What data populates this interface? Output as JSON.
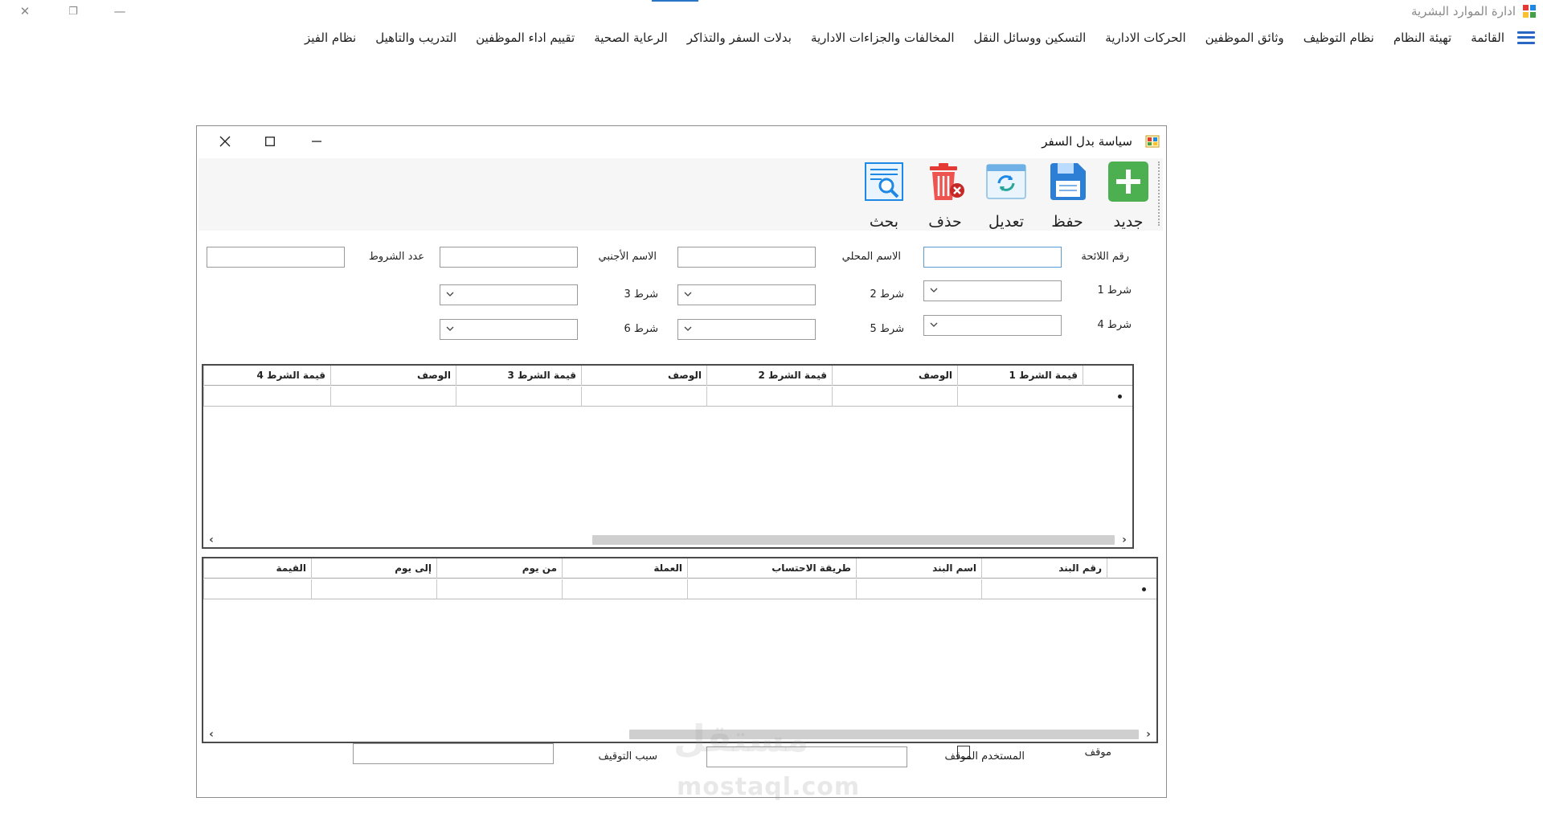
{
  "app": {
    "title": "ادارة الموارد البشرية",
    "minimize_glyph": "—",
    "restore_glyph": "❐",
    "close_glyph": "✕"
  },
  "menu": {
    "items": [
      {
        "label": "القائمة"
      },
      {
        "label": "تهيئة النظام"
      },
      {
        "label": "نظام التوظيف"
      },
      {
        "label": "وثائق الموظفين"
      },
      {
        "label": "الحركات الادارية"
      },
      {
        "label": "التسكين ووسائل النقل"
      },
      {
        "label": "المخالفات والجزاءات الادارية"
      },
      {
        "label": "بدلات السفر والتذاكر"
      },
      {
        "label": "الرعاية الصحية"
      },
      {
        "label": "تقييم اداء الموظفين"
      },
      {
        "label": "التدريب والتاهيل"
      },
      {
        "label": "نظام الفيز"
      }
    ],
    "icon": "hamburger-icon"
  },
  "window": {
    "title": "سياسة بدل السفر",
    "icon": "window-app-icon"
  },
  "toolbar": {
    "new_label": "جديد",
    "save_label": "حفظ",
    "edit_label": "تعديل",
    "delete_label": "حذف",
    "search_label": "بحث",
    "colors": {
      "new": "#4caf50",
      "save": "#2d7fd6",
      "edit": "#1e88e5",
      "delete": "#e53935",
      "search": "#1e88e5"
    }
  },
  "form": {
    "regulation_number_label": "رقم اللائحة",
    "local_name_label": "الاسم المحلي",
    "foreign_name_label": "الاسم الأجنبي",
    "conditions_count_label": "عدد الشروط",
    "condition1_label": "شرط 1",
    "condition2_label": "شرط 2",
    "condition3_label": "شرط 3",
    "condition4_label": "شرط 4",
    "condition5_label": "شرط 5",
    "condition6_label": "شرط 6",
    "regulation_number_value": "",
    "local_name_value": "",
    "foreign_name_value": "",
    "conditions_count_value": ""
  },
  "grid1": {
    "columns": [
      "قيمة الشرط 1",
      "الوصف",
      "قيمة الشرط 2",
      "الوصف",
      "قيمة الشرط 3",
      "الوصف",
      "قيمة الشرط 4"
    ]
  },
  "grid2": {
    "columns": [
      "رقم البند",
      "اسم البند",
      "طريقة الاحتساب",
      "العملة",
      "من يوم",
      "إلى يوم",
      "القيمة"
    ]
  },
  "footer": {
    "stopped_label": "موقف",
    "stopping_user_label": "المستخدم الموقف",
    "stop_reason_label": "سبب التوقيف",
    "stopped_checked": false
  },
  "watermark": {
    "text_ar": "مستقل",
    "text_en": "mostaql.com"
  }
}
